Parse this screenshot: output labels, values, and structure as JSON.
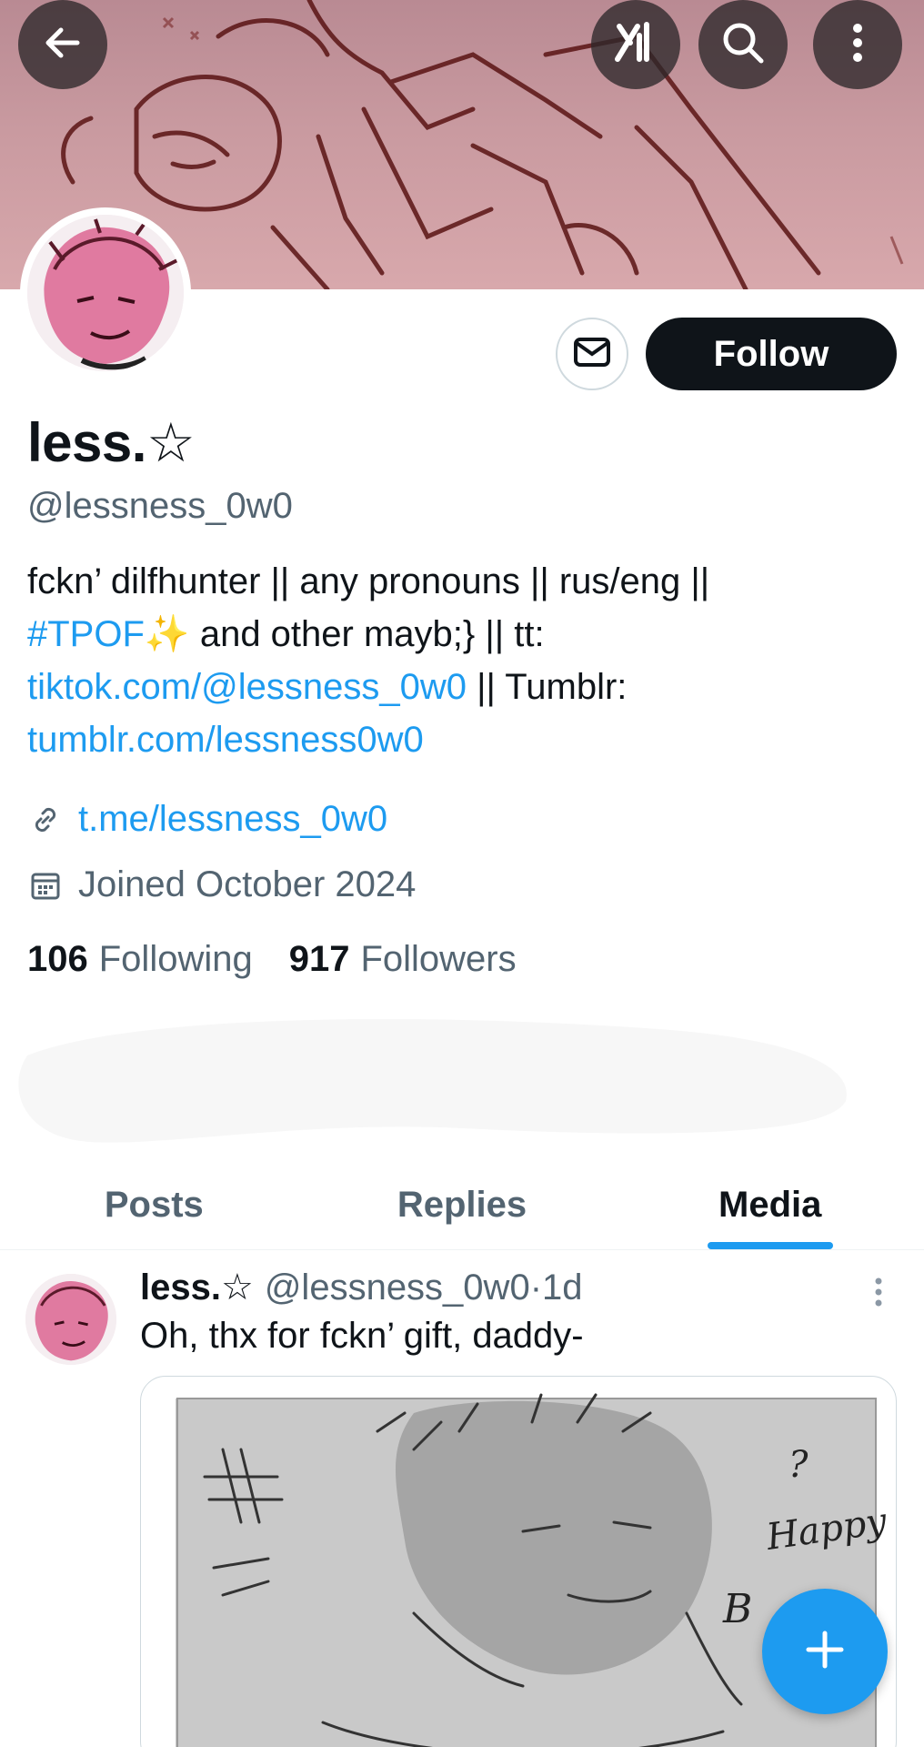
{
  "header": {
    "back_icon": "arrow-left-icon",
    "grok_icon": "grok-logo-icon",
    "search_icon": "search-icon",
    "more_icon": "more-vertical-icon"
  },
  "profile": {
    "display_name": "less.☆",
    "handle": "@lessness_0w0",
    "follow_label": "Follow",
    "bio": {
      "line1": "fckn’ dilfhunter || any pronouns || rus/eng ||",
      "hashtag": "#TPOF✨",
      "line2_rest": " and other mayb;} || tt: ",
      "tiktok_link": "tiktok.com/@lessness_0w0",
      "tumblr_prefix": " || Tumblr: ",
      "tumblr_link": "tumblr.com/lessness0w0"
    },
    "website": "t.me/lessness_0w0",
    "joined": "Joined October 2024",
    "following_count": "106",
    "following_label": "Following",
    "followers_count": "917",
    "followers_label": "Followers"
  },
  "tabs": [
    {
      "label": "Posts",
      "active": false
    },
    {
      "label": "Replies",
      "active": false
    },
    {
      "label": "Media",
      "active": true
    }
  ],
  "post": {
    "author_name": "less.☆",
    "author_handle": "@lessness_0w0",
    "separator": " · ",
    "time": "1d",
    "text": "Oh, thx for fckn’ gift, daddy-",
    "image_text": {
      "q": "?",
      "happy": "Happy",
      "b": "B"
    }
  },
  "colors": {
    "accent": "#1d9bf0",
    "text_primary": "#0f1419",
    "text_secondary": "#536471",
    "follow_bg": "#0f1419"
  }
}
